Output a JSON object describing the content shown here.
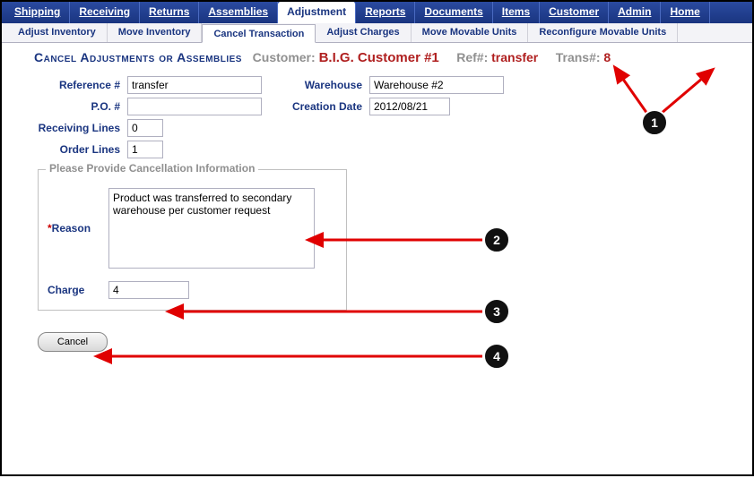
{
  "topnav": {
    "items": [
      "Shipping",
      "Receiving",
      "Returns",
      "Assemblies",
      "Adjustment",
      "Reports",
      "Documents",
      "Items",
      "Customer",
      "Admin",
      "Home"
    ],
    "activeIndex": 4
  },
  "subnav": {
    "items": [
      "Adjust Inventory",
      "Move Inventory",
      "Cancel Transaction",
      "Adjust Charges",
      "Move Movable Units",
      "Reconfigure Movable Units"
    ],
    "activeIndex": 2
  },
  "header": {
    "title": "Cancel Adjustments or Assemblies",
    "customerLabel": "Customer:",
    "customerValue": "B.I.G. Customer #1",
    "refLabel": "Ref#:",
    "refValue": "transfer",
    "transLabel": "Trans#:",
    "transValue": "8"
  },
  "form": {
    "referenceLabel": "Reference #",
    "referenceValue": "transfer",
    "warehouseLabel": "Warehouse",
    "warehouseValue": "Warehouse #2",
    "poLabel": "P.O. #",
    "poValue": "",
    "creationDateLabel": "Creation Date",
    "creationDateValue": "2012/08/21",
    "receivingLinesLabel": "Receiving Lines",
    "receivingLinesValue": "0",
    "orderLinesLabel": "Order Lines",
    "orderLinesValue": "1"
  },
  "cancelInfo": {
    "legend": "Please Provide Cancellation Information",
    "reasonLabel": "Reason",
    "reasonValue": "Product was transferred to secondary warehouse per customer request",
    "chargeLabel": "Charge",
    "chargeValue": "4"
  },
  "actions": {
    "cancel": "Cancel"
  },
  "annotations": {
    "1": "1",
    "2": "2",
    "3": "3",
    "4": "4"
  }
}
